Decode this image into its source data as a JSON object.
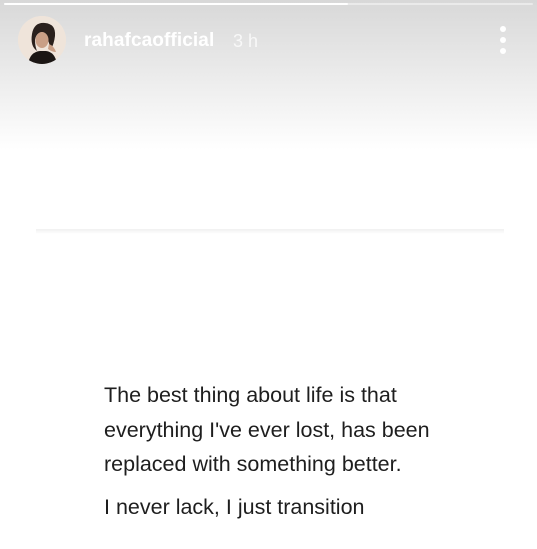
{
  "story": {
    "progress_fraction": 0.65,
    "username": "rahafcaofficial",
    "time": "3 h",
    "quote_lines": [
      "The best thing about life is that",
      "everything I've ever lost, has been",
      "replaced with something better."
    ],
    "quote_last": "I never lack, I just transition"
  },
  "icons": {
    "avatar": "profile-photo",
    "more": "more-vertical-icon"
  },
  "colors": {
    "header_text": "#ffffff",
    "body_text": "#1e1e1e",
    "background": "#ffffff"
  }
}
